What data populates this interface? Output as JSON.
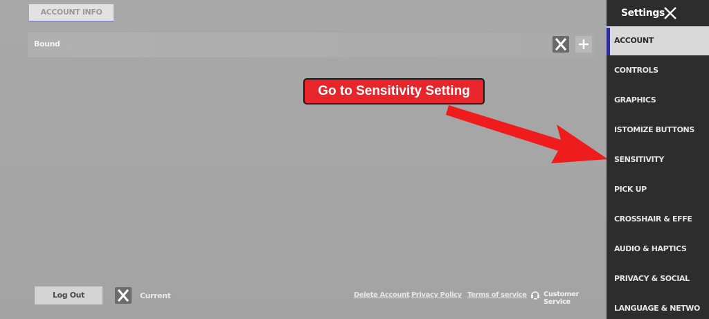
{
  "main": {
    "account_tab": "ACCOUNT INFO",
    "bound_label": "Bound",
    "log_out": "Log Out",
    "current_label": "Current",
    "footer_links": [
      "Delete Account",
      "Privacy Policy",
      "Terms of service"
    ],
    "customer_service": "Customer Service"
  },
  "callout": {
    "text": "Go to Sensitivity Setting",
    "color": "#e8252a"
  },
  "sidebar": {
    "title": "Settings",
    "items": [
      "ACCOUNT",
      "CONTROLS",
      "GRAPHICS",
      "ISTOMIZE BUTTONS",
      "SENSITIVITY",
      "PICK UP",
      "CROSSHAIR & EFFE",
      "AUDIO & HAPTICS",
      "PRIVACY & SOCIAL",
      "LANGUAGE & NETWO"
    ],
    "active_item": "ACCOUNT"
  },
  "icons": [
    "x-logo-icon",
    "plus-icon",
    "close-icon",
    "headset-icon"
  ]
}
